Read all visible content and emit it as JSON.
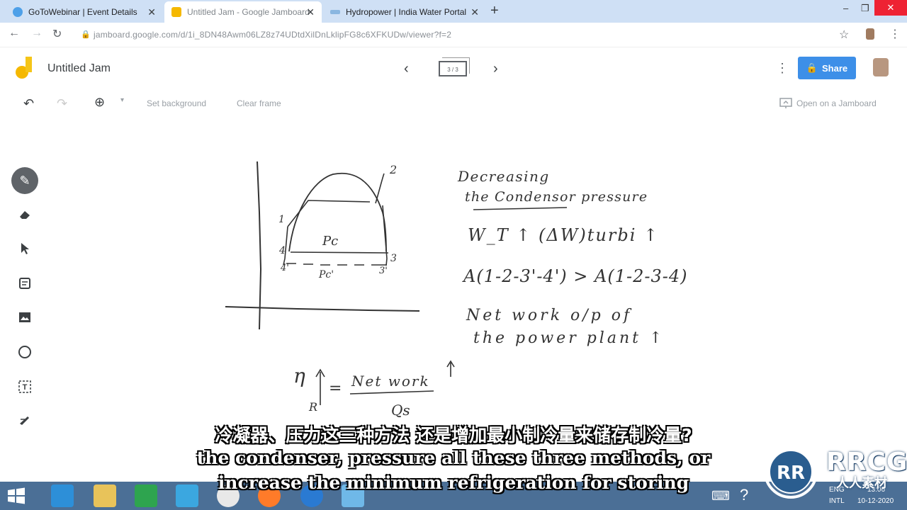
{
  "browser": {
    "tabs": [
      {
        "title": "GoToWebinar | Event Details",
        "active": false
      },
      {
        "title": "Untitled Jam - Google Jamboard",
        "active": true
      },
      {
        "title": "Hydropower | India Water Portal",
        "active": false
      }
    ],
    "url": "jamboard.google.com/d/1i_8DN48Awm06LZ8z74UDtdXilDnLklipFG8c6XFKUDw/viewer?f=2"
  },
  "app": {
    "title": "Untitled Jam",
    "frame_indicator": "3 / 3",
    "share_label": "Share",
    "open_on_jamboard": "Open on a Jamboard"
  },
  "toolbar": {
    "set_background": "Set background",
    "clear_frame": "Clear frame"
  },
  "tools": [
    "pen-icon",
    "eraser-icon",
    "select-icon",
    "sticky-note-icon",
    "image-icon",
    "circle-icon",
    "text-box-icon",
    "laser-icon"
  ],
  "canvas": {
    "diagram_labels": {
      "p1": "1",
      "p2": "2",
      "p3": "3",
      "p4": "4",
      "p3p": "3'",
      "p4p": "4'",
      "pc": "Pc",
      "pcp": "Pc'"
    },
    "notes": {
      "line1": "Decreasing",
      "line2": "the Condensor pressure",
      "line3": "W_T ↑ (ΔW)turbi ↑",
      "line4": "A(1-2-3'-4') > A(1-2-3-4)",
      "line5": "Net work o/p of",
      "line6": "the power plant ↑"
    },
    "formula": {
      "lhs": "η",
      "sub": "R",
      "numerator": "Net work",
      "denominator": "Qs"
    }
  },
  "subtitles": {
    "cn": "冷凝器、压力这三种方法 还是增加最小制冷量来储存制冷量?",
    "en_line1": "the condenser, pressure all these three methods, or",
    "en_line2": "increase the minimum refrigeration for storing"
  },
  "watermark": {
    "logo_text": "RRCG",
    "logo_sub": "人人素材"
  },
  "tray": {
    "lang1": "ENG",
    "lang2": "INTL",
    "time": "13:06",
    "date": "10-12-2020"
  },
  "colors": {
    "share": "#3d8fe8",
    "taskbar": "#4b6f96",
    "tabstrip": "#cfe0f5"
  }
}
